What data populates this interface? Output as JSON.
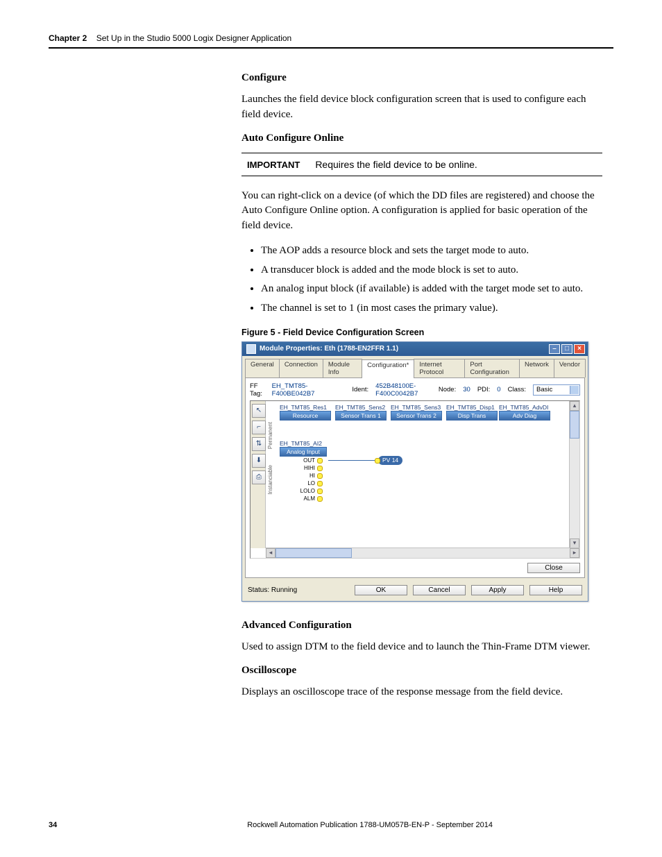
{
  "header": {
    "chapter": "Chapter 2",
    "title": "Set Up in the Studio 5000 Logix Designer Application"
  },
  "sections": {
    "configure_h": "Configure",
    "configure_p": "Launches the field device block configuration screen that is used to configure each field device.",
    "auto_h": "Auto Configure Online",
    "important_label": "IMPORTANT",
    "important_text": "Requires the field device to be online.",
    "auto_p": "You can right-click on a device (of which the DD files are registered) and choose the Auto Configure Online option. A configuration is applied for basic operation of the field device.",
    "bullets": [
      "The AOP adds a resource block and sets the target mode to auto.",
      "A transducer block is added and the mode block is set to auto.",
      "An analog input block (if available) is added with the target mode set to auto.",
      "The channel is set to 1 (in most cases the primary value)."
    ],
    "figure_caption": "Figure 5 - Field Device Configuration Screen",
    "advanced_h": "Advanced Configuration",
    "advanced_p": "Used to assign DTM to the field device and to launch the Thin-Frame DTM viewer.",
    "osc_h": "Oscilloscope",
    "osc_p": "Displays an oscilloscope trace of the response message from the field device."
  },
  "screenshot": {
    "title": "Module Properties: Eth (1788-EN2FFR 1.1)",
    "tabs": [
      "General",
      "Connection",
      "Module Info",
      "Configuration*",
      "Internet Protocol",
      "Port Configuration",
      "Network",
      "Vendor"
    ],
    "active_tab": 3,
    "ff_tag_label": "FF Tag:",
    "ff_tag": "EH_TMT85-F400BE042B7",
    "ident_label": "Ident:",
    "ident": "452B48100E-F400C0042B7",
    "node_label": "Node:",
    "node": "30",
    "pdi_label": "PDI:",
    "pdi": "0",
    "class_label": "Class:",
    "class_value": "Basic",
    "perm_label": "Permanent",
    "inst_label": "Instanciable",
    "blocks": [
      {
        "name": "EH_TMT85_Res1",
        "type": "Resource"
      },
      {
        "name": "EH_TMT85_Sens2",
        "type": "Sensor Trans 1"
      },
      {
        "name": "EH_TMT85_Sens3",
        "type": "Sensor Trans 2"
      },
      {
        "name": "EH_TMT85_Disp1",
        "type": "Disp Trans"
      },
      {
        "name": "EH_TMT85_AdvDI",
        "type": "Adv Diag"
      }
    ],
    "ai_block": {
      "name": "EH_TMT85_AI2",
      "type": "Analog Input"
    },
    "ai_ports": [
      "OUT",
      "HIHI",
      "HI",
      "LO",
      "LOLO",
      "ALM"
    ],
    "pv_tag": "PV 14",
    "close_btn": "Close",
    "status_label": "Status:",
    "status_value": "Running",
    "buttons": [
      "OK",
      "Cancel",
      "Apply",
      "Help"
    ]
  },
  "footer": {
    "page": "34",
    "pub": "Rockwell Automation Publication 1788-UM057B-EN-P - September 2014"
  }
}
